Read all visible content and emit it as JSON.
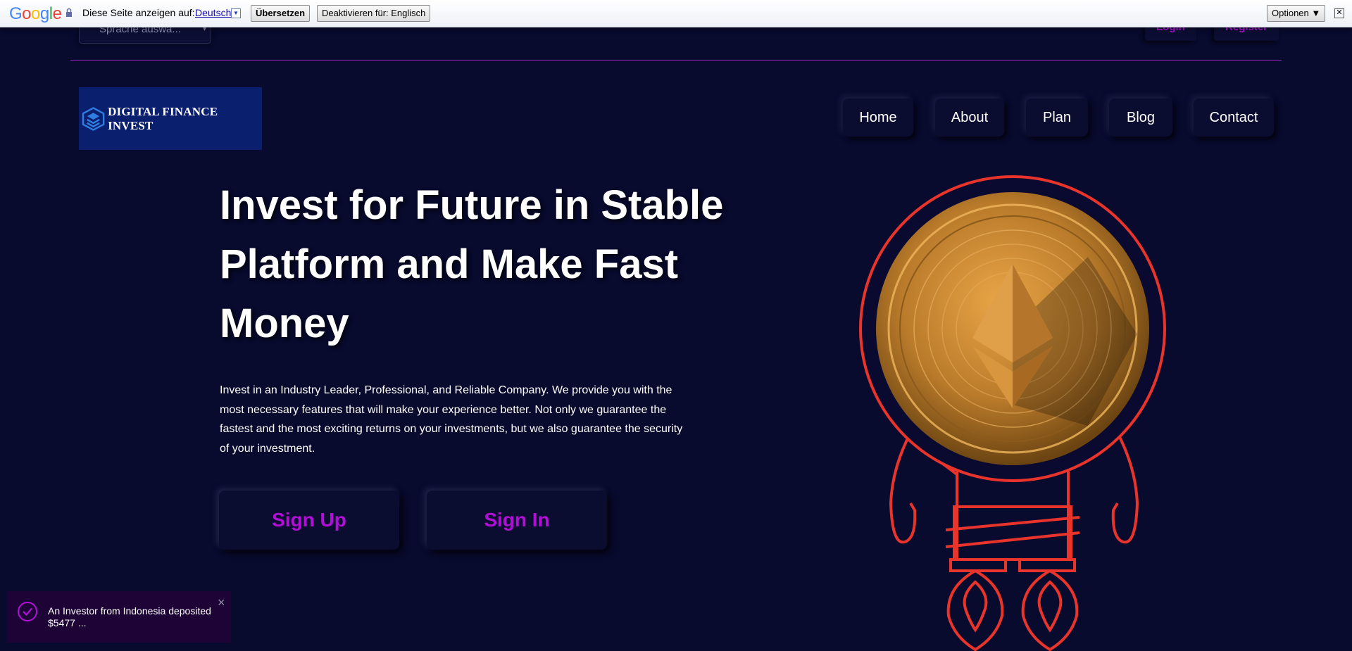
{
  "translate_bar": {
    "logo_letters": [
      "G",
      "o",
      "o",
      "g",
      "l",
      "e"
    ],
    "logo_colors": [
      "#4285f4",
      "#ea4335",
      "#fbbc05",
      "#4285f4",
      "#34a853",
      "#ea4335"
    ],
    "prompt": "Diese Seite anzeigen auf:",
    "language": "Deutsch",
    "translate_button": "Übersetzen",
    "disable_button": "Deaktivieren für: Englisch",
    "options_button": "Optionen ▼",
    "close_glyph": "✕"
  },
  "header": {
    "language_select": "Sprache auswä...",
    "login": "Login",
    "register": "Register"
  },
  "logo": {
    "text": "DIGITAL FINANCE INVEST"
  },
  "nav": {
    "items": [
      "Home",
      "About",
      "Plan",
      "Blog",
      "Contact"
    ]
  },
  "hero": {
    "title": "Invest for Future in Stable Platform and Make Fast Money",
    "description": "Invest in an Industry Leader, Professional, and Reliable Company. We provide you with the most necessary features that will make your experience better. Not only we guarantee the fastest and the most exciting returns on your investments, but we also guarantee the security of your investment.",
    "signup": "Sign Up",
    "signin": "Sign In"
  },
  "toast": {
    "message": "An Investor from Indonesia deposited $5477 ...",
    "close": "×"
  },
  "colors": {
    "background": "#080a2e",
    "accent": "#b10fd6",
    "rocket_outline": "#e8342a",
    "coin": "#c98a2c"
  }
}
